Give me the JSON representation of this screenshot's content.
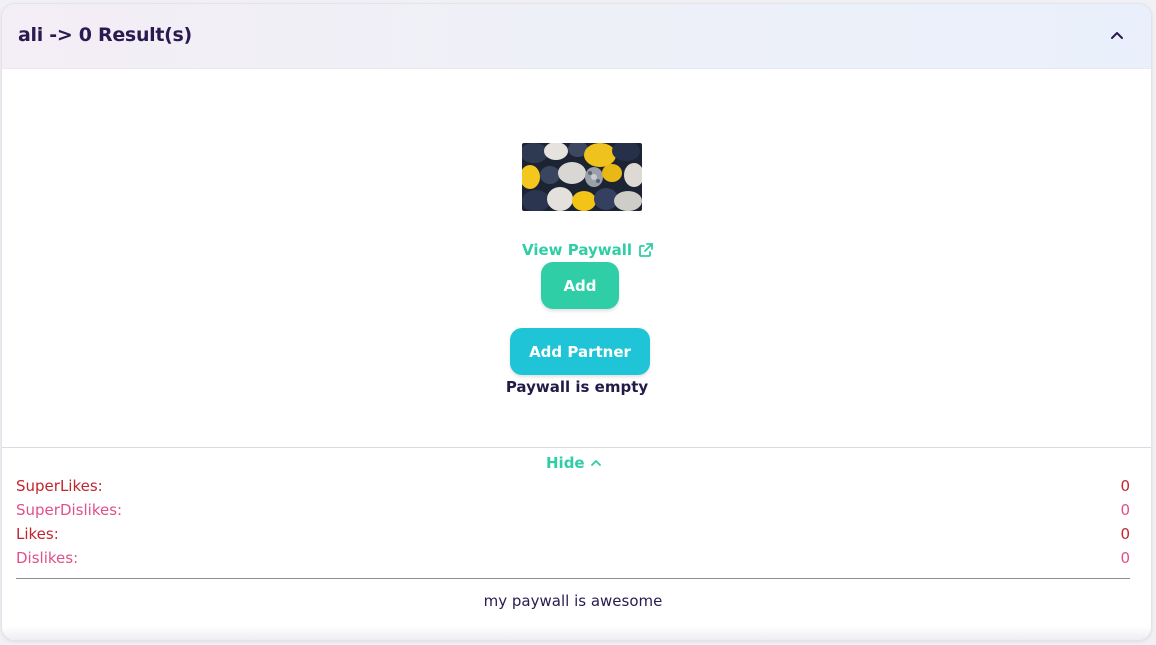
{
  "header": {
    "title": "ali -> 0 Result(s)"
  },
  "paywall": {
    "image_alt": "pebbles",
    "view_link_label": "View Paywall",
    "add_button_label": "Add",
    "add_partner_button_label": "Add Partner",
    "empty_message": "Paywall is empty"
  },
  "stats_toggle": {
    "label": "Hide"
  },
  "stats": [
    {
      "label": "SuperLikes:",
      "value": "0"
    },
    {
      "label": "SuperDislikes:",
      "value": "0"
    },
    {
      "label": "Likes:",
      "value": "0"
    },
    {
      "label": "Dislikes:",
      "value": "0"
    }
  ],
  "description": "my paywall is awesome",
  "colors": {
    "accent_green": "#2fcea6",
    "accent_cyan": "#1fc5d6",
    "title_navy": "#2a1a4f",
    "stat_red": "#c1262f",
    "stat_pink": "#e0508a"
  }
}
